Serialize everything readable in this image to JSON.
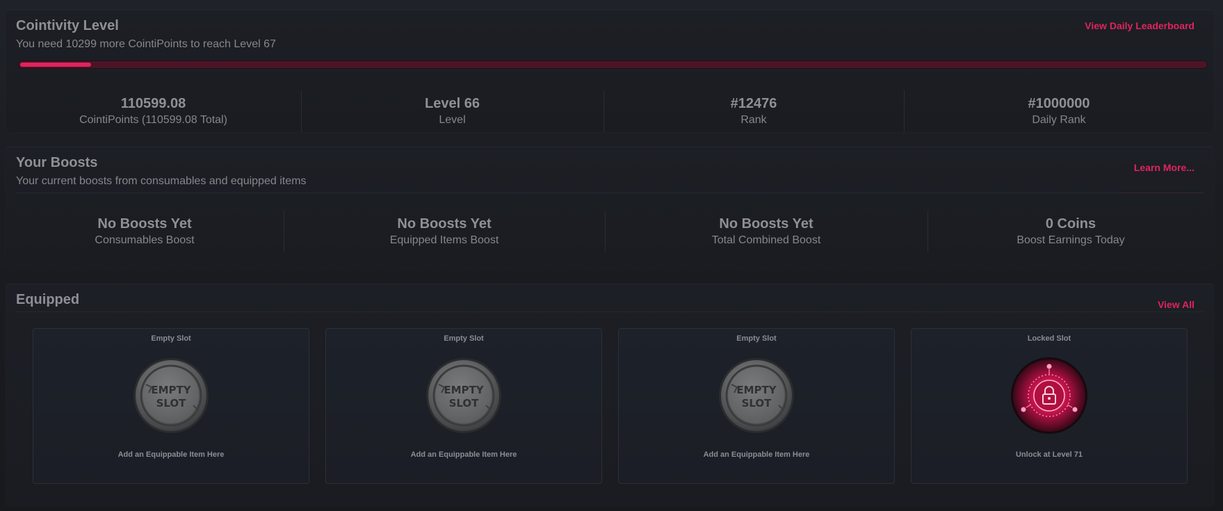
{
  "level_card": {
    "title": "Cointivity Level",
    "subtitle": "You need 10299 more CointiPoints to reach Level 67",
    "link": "View Daily Leaderboard",
    "progress_fraction": 0.06,
    "accent_color": "#e0245e",
    "stats": [
      {
        "value": "110599.08",
        "label": "CointiPoints (110599.08 Total)"
      },
      {
        "value": "Level 66",
        "label": "Level"
      },
      {
        "value": "#12476",
        "label": "Rank"
      },
      {
        "value": "#1000000",
        "label": "Daily Rank"
      }
    ]
  },
  "boosts_card": {
    "title": "Your Boosts",
    "subtitle": "Your current boosts from consumables and equipped items",
    "link": "Learn More...",
    "stats": [
      {
        "value": "No Boosts Yet",
        "label": "Consumables Boost"
      },
      {
        "value": "No Boosts Yet",
        "label": "Equipped Items Boost"
      },
      {
        "value": "No Boosts Yet",
        "label": "Total Combined Boost"
      },
      {
        "value": "0 Coins",
        "label": "Boost Earnings Today"
      }
    ]
  },
  "equipped_card": {
    "title": "Equipped",
    "link": "View All",
    "slots": [
      {
        "title": "Empty Slot",
        "icon": "empty-slot-icon",
        "icon_text": [
          "EMPTY",
          "SLOT"
        ],
        "caption": "Add an Equippable Item Here"
      },
      {
        "title": "Empty Slot",
        "icon": "empty-slot-icon",
        "icon_text": [
          "EMPTY",
          "SLOT"
        ],
        "caption": "Add an Equippable Item Here"
      },
      {
        "title": "Empty Slot",
        "icon": "empty-slot-icon",
        "icon_text": [
          "EMPTY",
          "SLOT"
        ],
        "caption": "Add an Equippable Item Here"
      },
      {
        "title": "Locked Slot",
        "icon": "lock-icon",
        "caption": "Unlock at Level 71"
      }
    ]
  }
}
